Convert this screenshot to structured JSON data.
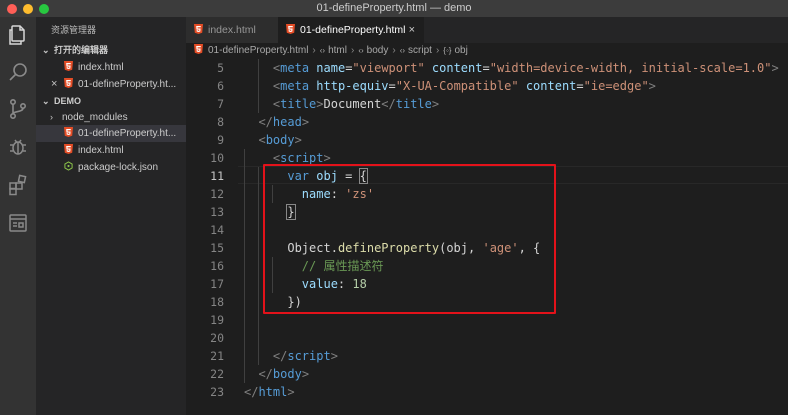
{
  "window": {
    "title": "01-defineProperty.html — demo"
  },
  "sidebar": {
    "header": "资源管理器",
    "open_editors_label": "打开的编辑器",
    "open_editors": [
      {
        "label": "index.html"
      },
      {
        "label": "01-defineProperty.ht..."
      }
    ],
    "workspace_label": "DEMO",
    "files": [
      {
        "label": "node_modules"
      },
      {
        "label": "01-defineProperty.ht..."
      },
      {
        "label": "index.html"
      },
      {
        "label": "package-lock.json"
      }
    ]
  },
  "tabs": [
    {
      "label": "index.html"
    },
    {
      "label": "01-defineProperty.html",
      "close": "×"
    }
  ],
  "breadcrumb": {
    "file": "01-defineProperty.html",
    "items": [
      "html",
      "body",
      "script",
      "obj"
    ],
    "item_icons": [
      "‹›",
      "‹›",
      "‹›",
      "{◦}"
    ]
  },
  "editor": {
    "line_numbers": [
      "5",
      "6",
      "7",
      "8",
      "9",
      "10",
      "11",
      "12",
      "13",
      "14",
      "15",
      "16",
      "17",
      "18",
      "19",
      "20",
      "21",
      "22",
      "23"
    ],
    "current_line": "11",
    "code": {
      "l5": {
        "indent": "    ",
        "open": "<",
        "tag": "meta",
        "a1": "name",
        "eq1": "=",
        "v1": "\"viewport\"",
        "a2": "content",
        "eq2": "=",
        "v2": "\"width=device-width, initial-scale=1.0\"",
        "close": ">"
      },
      "l6": {
        "indent": "    ",
        "open": "<",
        "tag": "meta",
        "a1": "http-equiv",
        "eq1": "=",
        "v1": "\"X-UA-Compatible\"",
        "a2": "content",
        "eq2": "=",
        "v2": "\"ie=edge\"",
        "close": ">"
      },
      "l7": {
        "indent": "    ",
        "open": "<",
        "tag": "title",
        "gt": ">",
        "text": "Document",
        "endopen": "</",
        "endtag": "title",
        "close": ">"
      },
      "l8": {
        "indent": "  ",
        "open": "</",
        "tag": "head",
        "close": ">"
      },
      "l9": {
        "indent": "  ",
        "open": "<",
        "tag": "body",
        "close": ">"
      },
      "l10": {
        "indent": "    ",
        "open": "<",
        "tag": "script",
        "close": ">"
      },
      "l11": {
        "indent": "      ",
        "kw": "var",
        "name": " obj",
        "rest": " = ",
        "brace": "{"
      },
      "l12": {
        "indent": "        ",
        "key": "name",
        "colon": ": ",
        "val": "'zs'"
      },
      "l13": {
        "indent": "      ",
        "brace": "}"
      },
      "l15": {
        "indent": "      ",
        "obj": "Object",
        "dot": ".",
        "fn": "defineProperty",
        "args1": "(obj, ",
        "str": "'age'",
        "args2": ", {"
      },
      "l16": {
        "indent": "        ",
        "comment": "// 属性描述符"
      },
      "l17": {
        "indent": "        ",
        "key": "value",
        "colon": ": ",
        "num": "18"
      },
      "l18": {
        "indent": "      ",
        "text": "})"
      },
      "l21": {
        "indent": "    ",
        "open": "</",
        "tag": "script",
        "close": ">"
      },
      "l22": {
        "indent": "  ",
        "open": "</",
        "tag": "body",
        "close": ">"
      },
      "l23": {
        "indent": "",
        "open": "</",
        "tag": "html",
        "close": ">"
      }
    }
  },
  "colors": {
    "highlight_box": "#e3121a",
    "html_file_icon": "#e44d26",
    "json_icon": "#8bc34a"
  },
  "icons": [
    "files-icon",
    "search-icon",
    "source-control-icon",
    "debug-icon",
    "extensions-icon",
    "remote-explorer-icon",
    "html5-file-icon",
    "json-file-icon",
    "folder-chevron-icon",
    "close-icon"
  ]
}
